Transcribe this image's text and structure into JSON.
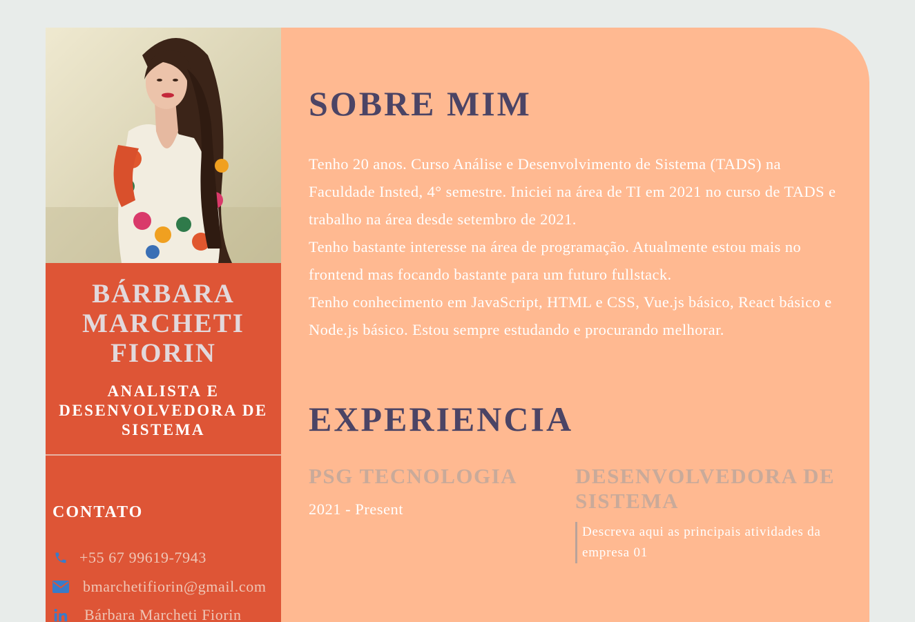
{
  "profile": {
    "name": "BÁRBARA MARCHETI FIORIN",
    "role": "ANALISTA E DESENVOLVEDORA DE SISTEMA"
  },
  "contact": {
    "title": "CONTATO",
    "phone": "+55 67 99619-7943",
    "email": "bmarchetifiorin@gmail.com",
    "linkedin": "Bárbara Marcheti Fiorin"
  },
  "about": {
    "title": "SOBRE MIM",
    "paragraph_1": "Tenho 20 anos. Curso Análise e Desenvolvimento de Sistema (TADS) na Faculdade Insted, 4° semestre. Iniciei na área de TI em 2021 no curso de TADS e trabalho na área desde setembro de 2021.",
    "paragraph_2": "Tenho bastante interesse na área de programação. Atualmente estou mais no frontend mas focando bastante para um futuro fullstack.",
    "paragraph_3": "Tenho conhecimento em JavaScript, HTML e CSS, Vue.js básico, React básico e Node.js básico. Estou sempre estudando e procurando melhorar."
  },
  "experience": {
    "title": "EXPERIENCIA",
    "company": "PSG TECNOLOGIA",
    "period": "2021 - Present",
    "job_title": "DESENVOLVEDORA DE SISTEMA",
    "description": "Descreva aqui as principais atividades da empresa 01"
  },
  "icons": {
    "phone": "phone-icon",
    "email": "envelope-icon",
    "linkedin": "linkedin-icon"
  },
  "colors": {
    "page_background": "#e8ecea",
    "sidebar": "#de5536",
    "main_panel": "#ffb991",
    "heading": "#4b4465",
    "icon_blue": "#3a7bc8"
  }
}
